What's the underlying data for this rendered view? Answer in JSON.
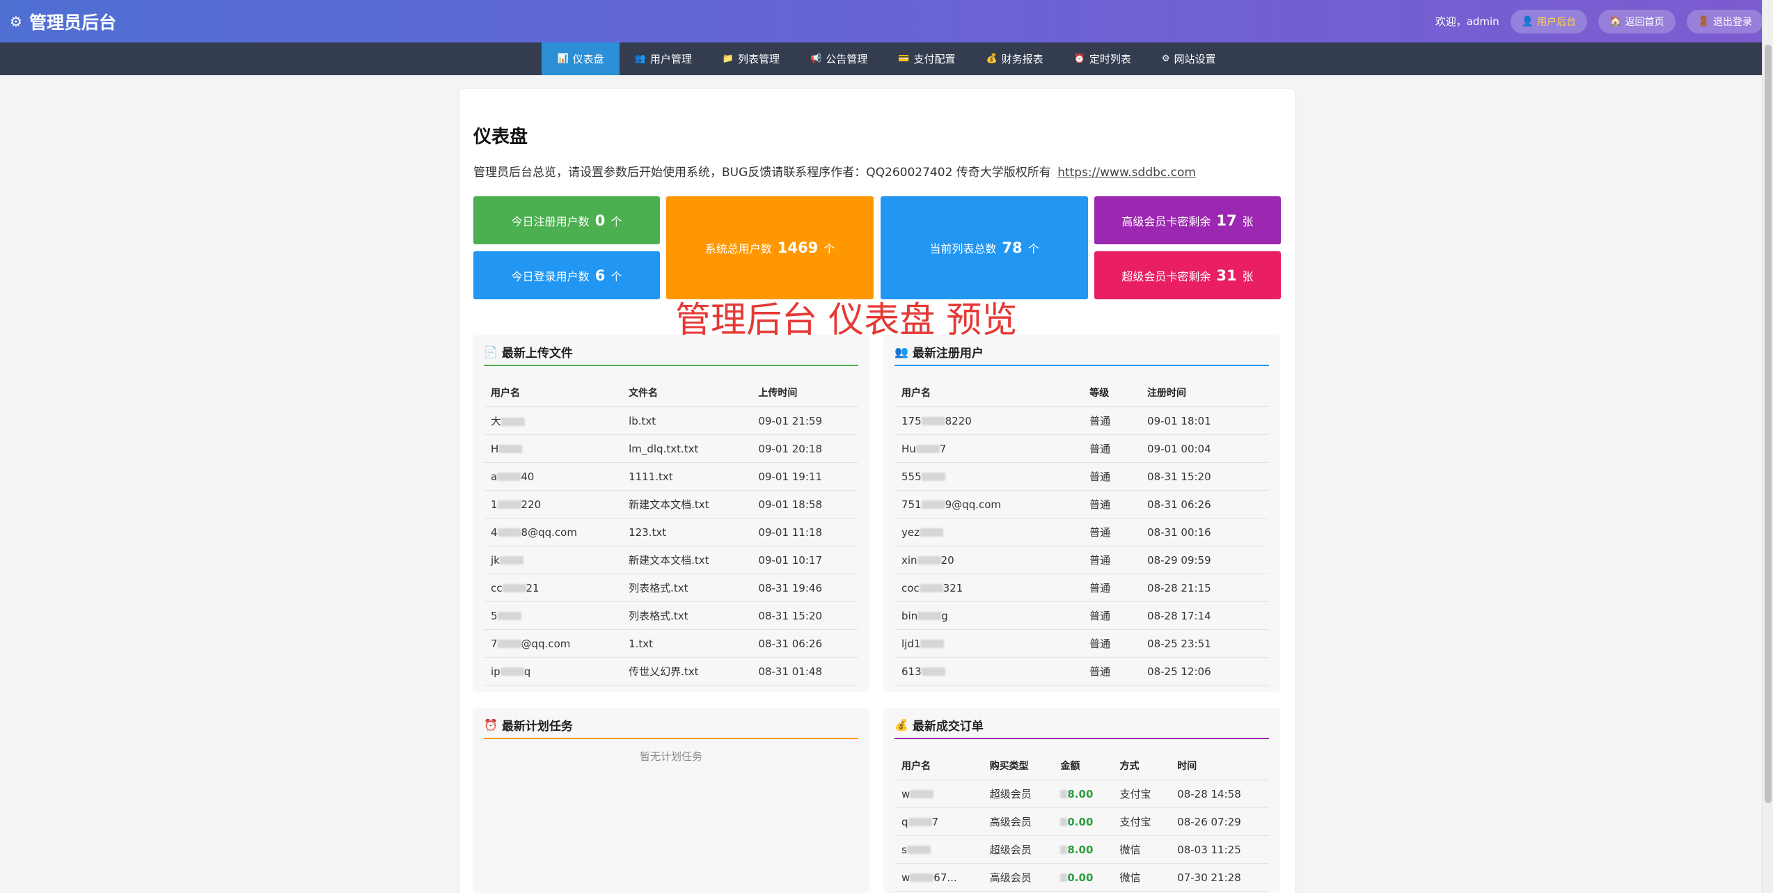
{
  "header": {
    "title": "管理员后台",
    "welcome": "欢迎，admin",
    "buttons": [
      "用户后台",
      "返回首页",
      "退出登录"
    ]
  },
  "nav": [
    "仪表盘",
    "用户管理",
    "列表管理",
    "公告管理",
    "支付配置",
    "财务报表",
    "定时列表",
    "网站设置"
  ],
  "page": {
    "title": "仪表盘",
    "desc": "管理员后台总览，请设置参数后开始使用系统，BUG反馈请联系程序作者：QQ260027402 传奇大学版权所有",
    "link": "https://www.sddbc.com"
  },
  "stats": {
    "today_reg": {
      "label": "今日注册用户数",
      "value": "0",
      "unit": "个"
    },
    "today_login": {
      "label": "今日登录用户数",
      "value": "6",
      "unit": "个"
    },
    "total_users": {
      "label": "系统总用户数",
      "value": "1469",
      "unit": "个"
    },
    "total_lists": {
      "label": "当前列表总数",
      "value": "78",
      "unit": "个"
    },
    "adv_cards": {
      "label": "高级会员卡密剩余",
      "value": "17",
      "unit": "张"
    },
    "super_cards": {
      "label": "超级会员卡密剩余",
      "value": "31",
      "unit": "张"
    }
  },
  "overlay": "管理后台 仪表盘 预览",
  "uploads": {
    "title": "最新上传文件",
    "columns": [
      "用户名",
      "文件名",
      "上传时间"
    ],
    "rows": [
      {
        "user_a": "大",
        "user_b": "",
        "file": "lb.txt",
        "time": "09-01 21:59"
      },
      {
        "user_a": "H",
        "user_b": "",
        "file": "lm_dlq.txt.txt",
        "time": "09-01 20:18"
      },
      {
        "user_a": "a",
        "user_b": "40",
        "file": "1111.txt",
        "time": "09-01 19:11"
      },
      {
        "user_a": "1",
        "user_b": "220",
        "file": "新建文本文档.txt",
        "time": "09-01 18:58"
      },
      {
        "user_a": "4",
        "user_b": "8@qq.com",
        "file": "123.txt",
        "time": "09-01 11:18"
      },
      {
        "user_a": "jk",
        "user_b": "",
        "file": "新建文本文档.txt",
        "time": "09-01 10:17"
      },
      {
        "user_a": "cc",
        "user_b": "21",
        "file": "列表格式.txt",
        "time": "08-31 19:46"
      },
      {
        "user_a": "5",
        "user_b": "",
        "file": "列表格式.txt",
        "time": "08-31 15:20"
      },
      {
        "user_a": "7",
        "user_b": "@qq.com",
        "file": "1.txt",
        "time": "08-31 06:26"
      },
      {
        "user_a": "ip",
        "user_b": "q",
        "file": "传世乂幻界.txt",
        "time": "08-31 01:48"
      }
    ]
  },
  "new_users": {
    "title": "最新注册用户",
    "columns": [
      "用户名",
      "等级",
      "注册时间"
    ],
    "rows": [
      {
        "user_a": "175",
        "user_b": "8220",
        "level": "普通",
        "time": "09-01 18:01"
      },
      {
        "user_a": "Hu",
        "user_b": "7",
        "level": "普通",
        "time": "09-01 00:04"
      },
      {
        "user_a": "555",
        "user_b": "",
        "level": "普通",
        "time": "08-31 15:20"
      },
      {
        "user_a": "751",
        "user_b": "9@qq.com",
        "level": "普通",
        "time": "08-31 06:26"
      },
      {
        "user_a": "yez",
        "user_b": "",
        "level": "普通",
        "time": "08-31 00:16"
      },
      {
        "user_a": "xin",
        "user_b": "20",
        "level": "普通",
        "time": "08-29 09:59"
      },
      {
        "user_a": "coc",
        "user_b": "321",
        "level": "普通",
        "time": "08-28 21:15"
      },
      {
        "user_a": "bin",
        "user_b": "g",
        "level": "普通",
        "time": "08-28 17:14"
      },
      {
        "user_a": "ljd1",
        "user_b": "",
        "level": "普通",
        "time": "08-25 23:51"
      },
      {
        "user_a": "613",
        "user_b": "",
        "level": "普通",
        "time": "08-25 12:06"
      }
    ]
  },
  "tasks": {
    "title": "最新计划任务",
    "empty": "暂无计划任务"
  },
  "orders": {
    "title": "最新成交订单",
    "columns": [
      "用户名",
      "购买类型",
      "金额",
      "方式",
      "时间"
    ],
    "rows": [
      {
        "user_a": "w",
        "user_b": "",
        "type": "超级会员",
        "amount": "8.00",
        "method": "支付宝",
        "time": "08-28 14:58"
      },
      {
        "user_a": "q",
        "user_b": "7",
        "type": "高级会员",
        "amount": "0.00",
        "method": "支付宝",
        "time": "08-26 07:29"
      },
      {
        "user_a": "s",
        "user_b": "",
        "type": "超级会员",
        "amount": "8.00",
        "method": "微信",
        "time": "08-03 11:25"
      },
      {
        "user_a": "w",
        "user_b": "67...",
        "type": "高级会员",
        "amount": "0.00",
        "method": "微信",
        "time": "07-30 21:28"
      }
    ]
  },
  "colors": {
    "green": "#4caf50",
    "blue": "#2196f3",
    "orange": "#ff9800",
    "purple": "#9c27b0",
    "pink": "#e91e63",
    "nav_active": "#2c8fd6"
  }
}
